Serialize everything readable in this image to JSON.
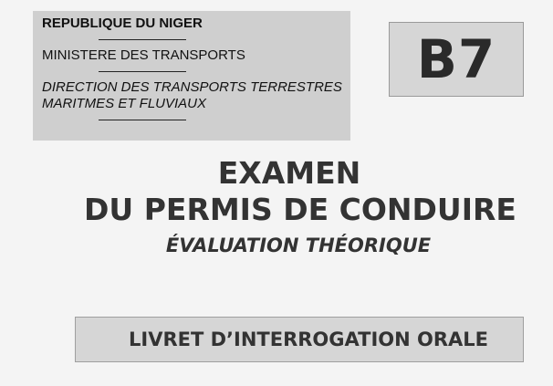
{
  "header": {
    "country": "REPUBLIQUE DU  NIGER",
    "ministry": "MINISTERE DES TRANSPORTS",
    "direction_line1": "DIRECTION DES TRANSPORTS TERRESTRES",
    "direction_line2": "MARITMES ET FLUVIAUX"
  },
  "badge": {
    "code": "B7"
  },
  "title": {
    "line1": "EXAMEN",
    "line2": "DU PERMIS DE CONDUIRE",
    "line3": "ÉVALUATION THÉORIQUE"
  },
  "booklet": {
    "label": "LIVRET D’INTERROGATION ORALE"
  }
}
